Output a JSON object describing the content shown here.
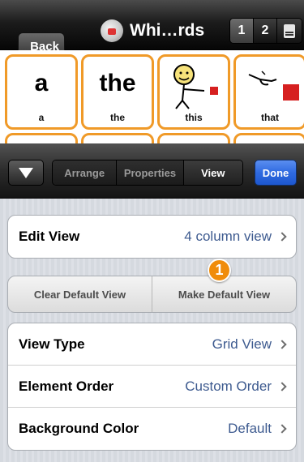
{
  "navbar": {
    "back_label": "Back",
    "title": "Whi…rds",
    "page_buttons": [
      "1",
      "2"
    ],
    "icon": "board-doc-icon"
  },
  "grid": {
    "cells": [
      {
        "word": "a",
        "caption": "a"
      },
      {
        "word": "the",
        "caption": "the"
      },
      {
        "caption": "this",
        "icon": "person-pointing-red-square"
      },
      {
        "caption": "that",
        "icon": "hand-pointing-red-square"
      }
    ]
  },
  "toolbar": {
    "collapse_icon": "triangle-down-icon",
    "tabs": [
      "Arrange",
      "Properties",
      "View"
    ],
    "active_tab": "View",
    "done_label": "Done",
    "done_color": "#2f6ae0"
  },
  "edit_view": {
    "label": "Edit View",
    "value": "4 column view"
  },
  "default_buttons": {
    "clear": "Clear Default View",
    "make": "Make Default View"
  },
  "badge": {
    "text": "1",
    "color": "#f08c0a"
  },
  "view_settings": [
    {
      "label": "View Type",
      "value": "Grid View"
    },
    {
      "label": "Element Order",
      "value": "Custom Order"
    },
    {
      "label": "Background Color",
      "value": "Default"
    }
  ],
  "colors": {
    "cell_border": "#f09a28",
    "value_text": "#3d5a8f"
  }
}
